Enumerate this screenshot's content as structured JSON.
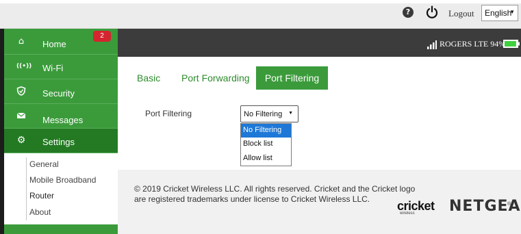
{
  "topbar": {
    "help_icon": "help-circle-icon",
    "power_icon": "power-icon",
    "logout_label": "Logout",
    "language_selected": "English"
  },
  "sidebar": {
    "items": [
      {
        "label": "Home",
        "icon": "home-icon"
      },
      {
        "label": "Wi-Fi",
        "icon": "wifi-icon",
        "badge": "2"
      },
      {
        "label": "Security",
        "icon": "shield-icon"
      },
      {
        "label": "Messages",
        "icon": "envelope-icon"
      },
      {
        "label": "Settings",
        "icon": "gears-icon",
        "active": true
      }
    ],
    "submenu": [
      {
        "label": "General"
      },
      {
        "label": "Mobile Broadband"
      },
      {
        "label": "Router",
        "active": true
      },
      {
        "label": "About"
      }
    ]
  },
  "status": {
    "carrier": "ROGERS",
    "network": "LTE",
    "battery": "94%",
    "battery_level": 0.94,
    "signal_icon": "signal-bars-icon",
    "battery_icon": "battery-icon"
  },
  "tabs": [
    {
      "label": "Basic"
    },
    {
      "label": "Port Forwarding"
    },
    {
      "label": "Port Filtering",
      "active": true
    }
  ],
  "port_filtering": {
    "label": "Port Filtering",
    "selected": "No Filtering",
    "options": [
      "No Filtering",
      "Block list",
      "Allow list"
    ]
  },
  "footer": {
    "copyright_line1": "© 2019 Cricket Wireless LLC. All rights reserved. Cricket and the Cricket logo",
    "copyright_line2": "are registered trademarks under license to Cricket Wireless LLC.",
    "brand_cricket": "cricket",
    "brand_cricket_sub": "wireless",
    "brand_netgear": "NETGEAR"
  },
  "colors": {
    "brand_green": "#3b9b3b",
    "active_green": "#237a23",
    "header_dark": "#3c3c3c",
    "badge_red": "#d4242f",
    "select_highlight": "#1e78d7"
  }
}
